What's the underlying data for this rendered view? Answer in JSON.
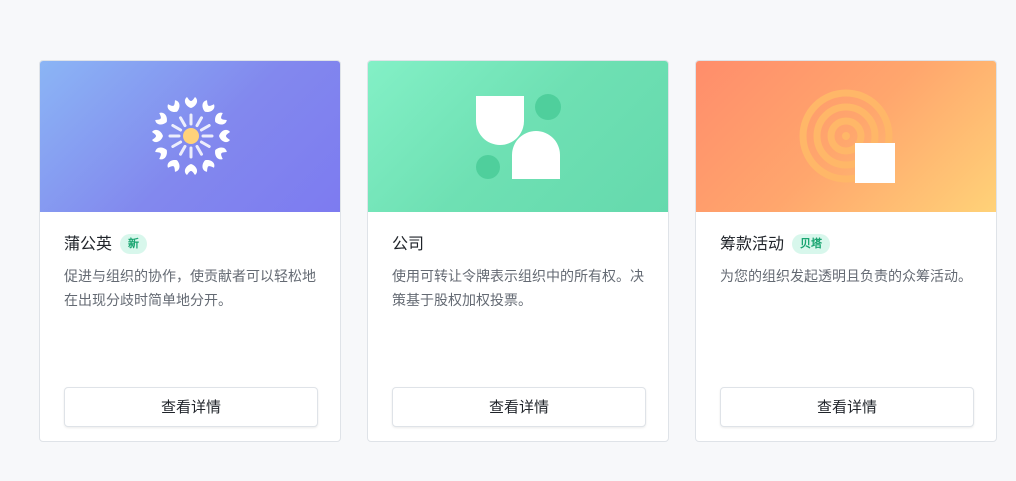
{
  "templates": [
    {
      "name": "蒲公英",
      "badge": "新",
      "description": "促进与组织的协作，使贡献者可以轻松地在出现分歧时简单地分开。",
      "button_label": "查看详情",
      "illustration": "dandelion-icon"
    },
    {
      "name": "公司",
      "description": "使用可转让令牌表示组织中的所有权。决策基于股权加权投票。",
      "button_label": "查看详情",
      "illustration": "company-shapes-icon"
    },
    {
      "name": "筹款活动",
      "badge": "贝塔",
      "description": "为您的组织发起透明且负责的众筹活动。",
      "button_label": "查看详情",
      "illustration": "fundraising-target-icon"
    }
  ],
  "colors": {
    "badge_background": "#d8f7ec",
    "badge_text": "#1aa571",
    "dandelion_gradient": [
      "#8bb5f5",
      "#7d7bf0"
    ],
    "company_gradient": [
      "#83f0c6",
      "#65d9ad"
    ],
    "fundraising_gradient": [
      "#ff8d6b",
      "#ffd278"
    ]
  }
}
